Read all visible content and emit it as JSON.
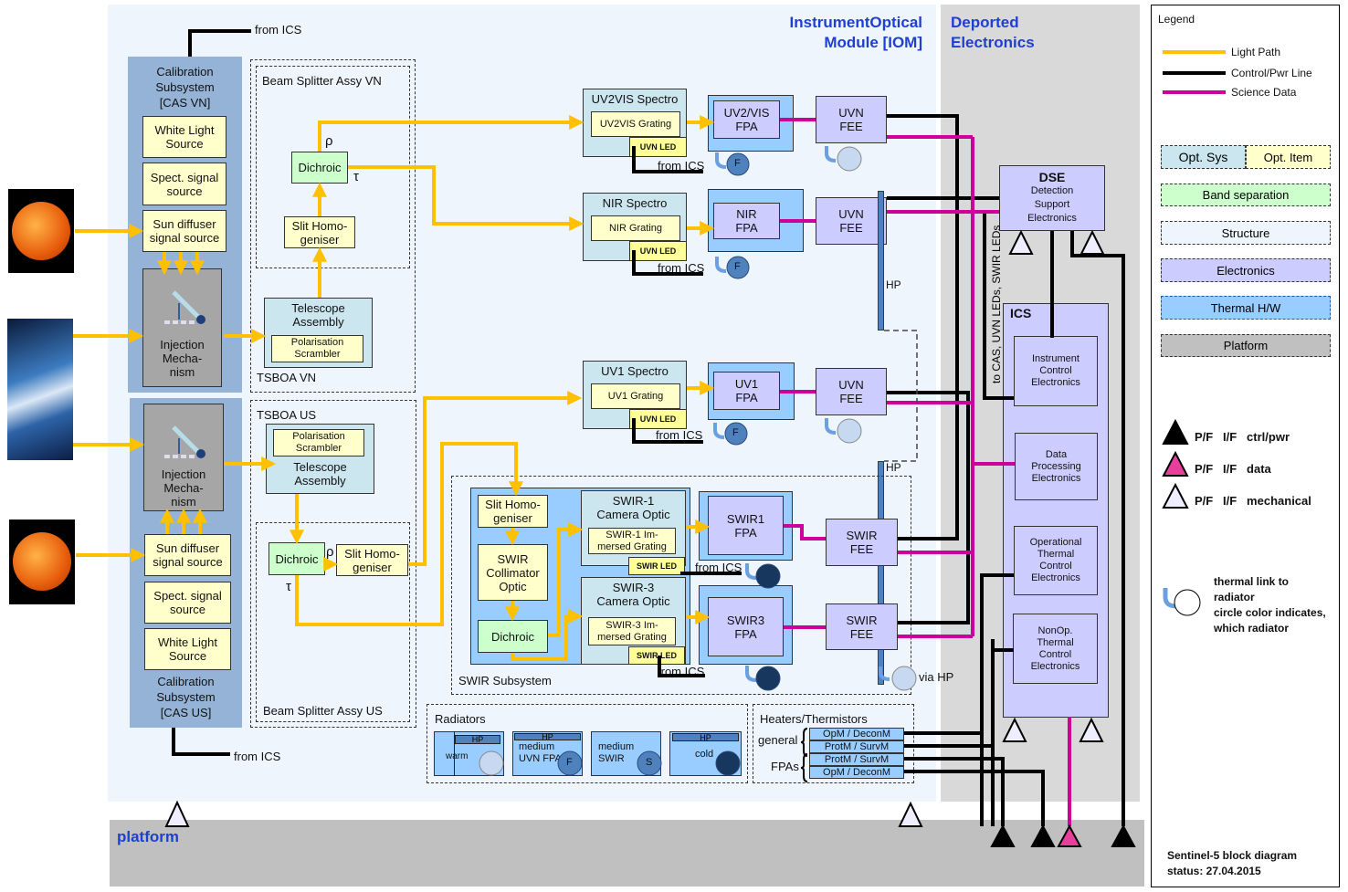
{
  "headers": {
    "iom": "InstrumentOptical\nModule  [IOM]",
    "deported": "Deported\nElectronics",
    "platform": "platform"
  },
  "colors": {
    "light_path": "#ffc000",
    "control_pwr": "#000000",
    "science_data": "#cc0099",
    "opt_sys": "#cce6f0",
    "opt_item": "#ffffcc",
    "band_separation": "#ccffcc",
    "structure": "#eef5fc",
    "electronics": "#ccccff",
    "thermal_hw": "#99ccff",
    "platform": "#c0c0c0"
  },
  "cas_vn": {
    "title": "Calibration\nSubsystem\n[CAS VN]",
    "white_light": "White Light\nSource",
    "spect": "Spect. signal\nsource",
    "sun_diffuser": "Sun diffuser\nsignal source",
    "injection": "Injection\nMecha-\nnism",
    "from_ics": "from ICS"
  },
  "cas_us": {
    "title": "Calibration\nSubsystem\n[CAS US]",
    "white_light": "White Light\nSource",
    "spect": "Spect. signal\nsource",
    "sun_diffuser": "Sun diffuser\nsignal source",
    "injection": "Injection\nMecha-\nnism",
    "from_ics": "from ICS"
  },
  "vn": {
    "beam_splitter": "Beam Splitter Assy VN",
    "dichroic": "Dichroic",
    "rho": "ρ",
    "tau": "τ",
    "slit": "Slit Homo-\ngeniser",
    "telescope": "Telescope\nAssembly",
    "scrambler": "Polarisation\nScrambler",
    "tsboa": "TSBOA VN"
  },
  "us": {
    "tsboa": "TSBOA US",
    "scrambler": "Polarisation\nScrambler",
    "telescope": "Telescope\nAssembly",
    "dichroic": "Dichroic",
    "rho": "ρ",
    "tau": "τ",
    "slit": "Slit Homo-\ngeniser",
    "beam_splitter": "Beam Splitter Assy US"
  },
  "uvn": {
    "channels": [
      {
        "spectro": "UV2VIS Spectro",
        "grating": "UV2VIS Grating",
        "led": "UVN LED",
        "from_ics": "from ICS",
        "fpa": "UV2/VIS\nFPA",
        "fee": "UVN\nFEE",
        "radiator_mark": "F"
      },
      {
        "spectro": "NIR Spectro",
        "grating": "NIR Grating",
        "led": "UVN LED",
        "from_ics": "from ICS",
        "fpa": "NIR\nFPA",
        "fee": "UVN\nFEE",
        "radiator_mark": "F"
      },
      {
        "spectro": "UV1 Spectro",
        "grating": "UV1 Grating",
        "led": "UVN LED",
        "from_ics": "from ICS",
        "fpa": "UV1\nFPA",
        "fee": "UVN\nFEE",
        "radiator_mark": "F"
      }
    ],
    "hp": "HP"
  },
  "swir": {
    "subsystem": "SWIR Subsystem",
    "slit": "Slit Homo-\ngeniser",
    "collimator": "SWIR\nCollimator\nOptic",
    "dichroic": "Dichroic",
    "cam1": "SWIR-1\nCamera Optic",
    "grating1": "SWIR-1 Im-\nmersed Grating",
    "cam3": "SWIR-3\nCamera Optic",
    "grating3": "SWIR-3 Im-\nmersed Grating",
    "led": "SWIR LED",
    "from_ics": "from ICS",
    "fpa1": "SWIR1\nFPA",
    "fpa3": "SWIR3\nFPA",
    "fee": "SWIR\nFEE",
    "hp": "HP",
    "via_hp": "via HP"
  },
  "radiators": {
    "title": "Radiators",
    "hp": "HP",
    "warm": "warm",
    "medium_uvn": "medium\nUVN FPA",
    "medium_swir": "medium\nSWIR",
    "cold": "cold",
    "f": "F",
    "s": "S"
  },
  "heaters": {
    "title": "Heaters/Thermistors",
    "general": "general",
    "fpas": "FPAs",
    "rows": [
      "OpM / DeconM",
      "ProtM / SurvM",
      "ProtM / SurvM",
      "OpM / DeconM"
    ]
  },
  "dse": {
    "title": "DSE",
    "name": "Detection\nSupport\nElectronics"
  },
  "to_cas": "to CAS, UVN LEDs, SWIR LEDs",
  "ics": {
    "title": "ICS",
    "units": [
      "Instrument\nControl\nElectronics",
      "Data\nProcessing\nElectronics",
      "Operational\nThermal\nControl\nElectronics",
      "NonOp.\nThermal\nControl\nElectronics"
    ]
  },
  "legend": {
    "title": "Legend",
    "lines": [
      "Light Path",
      "Control/Pwr  Line",
      "Science Data"
    ],
    "opt_sys": "Opt. Sys",
    "opt_item": "Opt. Item",
    "boxes": [
      "Band separation",
      "Structure",
      "Electronics",
      "Thermal H/W",
      "Platform"
    ],
    "triangles": [
      "P/F   I/F   ctrl/pwr",
      "P/F   I/F   data",
      "P/F   I/F   mechanical"
    ],
    "thermal": "thermal link  to\nradiator\ncircle color indicates,\nwhich radiator",
    "footer": "Sentinel-5 block diagram\nstatus: 27.04.2015"
  }
}
